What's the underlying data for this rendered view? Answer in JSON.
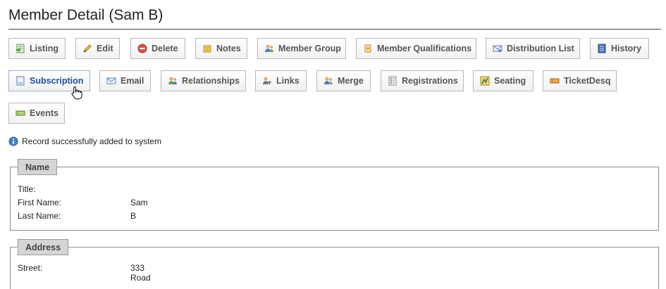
{
  "page": {
    "title": "Member Detail (Sam B)"
  },
  "toolbar": {
    "row1": [
      {
        "label": "Listing",
        "icon": "listing-icon"
      },
      {
        "label": "Edit",
        "icon": "pencil-icon"
      },
      {
        "label": "Delete",
        "icon": "delete-icon"
      },
      {
        "label": "Notes",
        "icon": "notes-icon"
      },
      {
        "label": "Member Group",
        "icon": "group-icon"
      },
      {
        "label": "Member Qualifications",
        "icon": "qualifications-icon"
      },
      {
        "label": "Distribution List",
        "icon": "distribution-list-icon"
      },
      {
        "label": "History",
        "icon": "history-icon"
      }
    ],
    "row2": [
      {
        "label": "Subscription",
        "icon": "subscription-icon"
      },
      {
        "label": "Email",
        "icon": "email-icon"
      },
      {
        "label": "Relationships",
        "icon": "relationships-icon"
      },
      {
        "label": "Links",
        "icon": "links-icon"
      },
      {
        "label": "Merge",
        "icon": "merge-icon"
      },
      {
        "label": "Registrations",
        "icon": "registrations-icon"
      },
      {
        "label": "Seating",
        "icon": "seating-icon"
      },
      {
        "label": "TicketDesq",
        "icon": "ticket-icon"
      }
    ],
    "row3": [
      {
        "label": "Events",
        "icon": "events-icon"
      }
    ]
  },
  "message": {
    "text": "Record successfully added to system",
    "icon": "info-icon"
  },
  "name_section": {
    "legend": "Name",
    "fields": [
      {
        "label": "Title:",
        "value": ""
      },
      {
        "label": "First Name:",
        "value": "Sam"
      },
      {
        "label": "Last Name:",
        "value": "B"
      }
    ]
  },
  "address_section": {
    "legend": "Address",
    "fields": [
      {
        "label": "Street:",
        "value": "333 Road"
      }
    ]
  },
  "colors": {
    "active_button_text": "#1f4fa0",
    "legend_bg": "#d5d5d5"
  }
}
